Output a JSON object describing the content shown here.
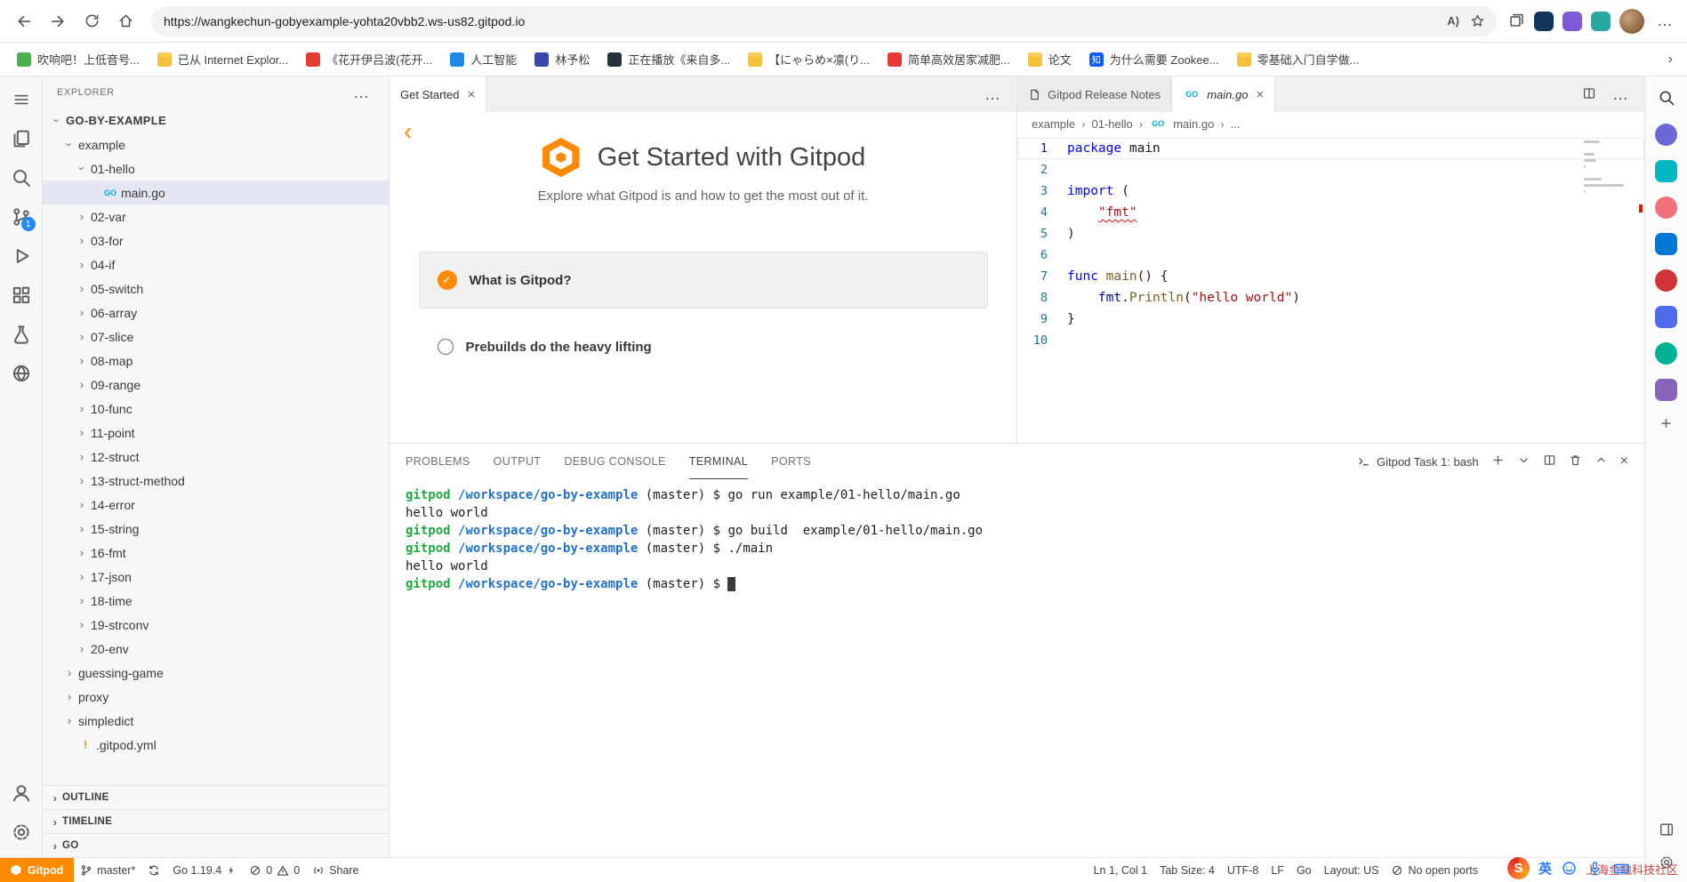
{
  "browser": {
    "toolbar": {
      "url": "https://wangkechun-gobyexample-yohta20vbb2.ws-us82.gitpod.io"
    },
    "bookmarks": [
      {
        "label": "吹响吧！上低音号...",
        "icon": "site",
        "color": "#4caf50"
      },
      {
        "label": "已从 Internet Explor...",
        "icon": "folder"
      },
      {
        "label": "《花开伊吕波(花开...",
        "icon": "site",
        "color": "#e53935"
      },
      {
        "label": "人工智能",
        "icon": "site",
        "color": "#1e88e5"
      },
      {
        "label": "林予松",
        "icon": "site",
        "color": "#3949ab"
      },
      {
        "label": "正在播放《来自多...",
        "icon": "site",
        "color": "#263238"
      },
      {
        "label": "【にゃらめ×凛(り...",
        "icon": "folder"
      },
      {
        "label": "简单高效居家减肥...",
        "icon": "site",
        "color": "#e53935"
      },
      {
        "label": "论文",
        "icon": "folder"
      },
      {
        "label": "为什么需要 Zookee...",
        "icon": "site",
        "color": "#0b5cff",
        "glyph": "知"
      },
      {
        "label": "零基础入门自学做...",
        "icon": "folder"
      }
    ]
  },
  "icons": {
    "go": "GO",
    "warn": "!",
    "read_aloud": "A)"
  },
  "activity": {
    "scm_badge": "1"
  },
  "sidebar": {
    "title": "EXPLORER",
    "tree": [
      {
        "label": "GO-BY-EXAMPLE",
        "level": 0,
        "arrow": "down",
        "root": true
      },
      {
        "label": "example",
        "level": 1,
        "arrow": "down"
      },
      {
        "label": "01-hello",
        "level": 2,
        "arrow": "down"
      },
      {
        "label": "main.go",
        "level": 3,
        "arrow": "none",
        "icon": "go",
        "selected": true
      },
      {
        "label": "02-var",
        "level": 2,
        "arrow": "right"
      },
      {
        "label": "03-for",
        "level": 2,
        "arrow": "right"
      },
      {
        "label": "04-if",
        "level": 2,
        "arrow": "right"
      },
      {
        "label": "05-switch",
        "level": 2,
        "arrow": "right"
      },
      {
        "label": "06-array",
        "level": 2,
        "arrow": "right"
      },
      {
        "label": "07-slice",
        "level": 2,
        "arrow": "right"
      },
      {
        "label": "08-map",
        "level": 2,
        "arrow": "right"
      },
      {
        "label": "09-range",
        "level": 2,
        "arrow": "right"
      },
      {
        "label": "10-func",
        "level": 2,
        "arrow": "right"
      },
      {
        "label": "11-point",
        "level": 2,
        "arrow": "right"
      },
      {
        "label": "12-struct",
        "level": 2,
        "arrow": "right"
      },
      {
        "label": "13-struct-method",
        "level": 2,
        "arrow": "right"
      },
      {
        "label": "14-error",
        "level": 2,
        "arrow": "right"
      },
      {
        "label": "15-string",
        "level": 2,
        "arrow": "right"
      },
      {
        "label": "16-fmt",
        "level": 2,
        "arrow": "right"
      },
      {
        "label": "17-json",
        "level": 2,
        "arrow": "right"
      },
      {
        "label": "18-time",
        "level": 2,
        "arrow": "right"
      },
      {
        "label": "19-strconv",
        "level": 2,
        "arrow": "right"
      },
      {
        "label": "20-env",
        "level": 2,
        "arrow": "right"
      },
      {
        "label": "guessing-game",
        "level": 1,
        "arrow": "right"
      },
      {
        "label": "proxy",
        "level": 1,
        "arrow": "right"
      },
      {
        "label": "simpledict",
        "level": 1,
        "arrow": "right"
      },
      {
        "label": ".gitpod.yml",
        "level": 1,
        "arrow": "none",
        "icon": "warn"
      }
    ],
    "sections": [
      "OUTLINE",
      "TIMELINE",
      "GO"
    ]
  },
  "get_started": {
    "tab": "Get Started",
    "title": "Get Started with Gitpod",
    "subtitle": "Explore what Gitpod is and how to get the most out of it.",
    "items": [
      {
        "label": "What is Gitpod?",
        "checked": true
      },
      {
        "label": "Prebuilds do the heavy lifting",
        "checked": false
      }
    ]
  },
  "editor": {
    "right_tabs": [
      "Gitpod Release Notes",
      "main.go"
    ],
    "breadcrumb": [
      "example",
      "01-hello",
      "main.go",
      "..."
    ],
    "lines": [
      {
        "num": "1",
        "cur": true,
        "tokens": [
          {
            "t": "package",
            "c": "kw"
          },
          {
            "t": " main",
            "c": "pl"
          }
        ]
      },
      {
        "num": "2",
        "tokens": []
      },
      {
        "num": "3",
        "tokens": [
          {
            "t": "import",
            "c": "kw"
          },
          {
            "t": " (",
            "c": "pl"
          }
        ]
      },
      {
        "num": "4",
        "tokens": [
          {
            "t": "    ",
            "c": "pl"
          },
          {
            "t": "\"fmt\"",
            "c": "str err"
          }
        ]
      },
      {
        "num": "5",
        "tokens": [
          {
            "t": ")",
            "c": "pl"
          }
        ]
      },
      {
        "num": "6",
        "tokens": []
      },
      {
        "num": "7",
        "tokens": [
          {
            "t": "func",
            "c": "kw"
          },
          {
            "t": " ",
            "c": "pl"
          },
          {
            "t": "main",
            "c": "fn"
          },
          {
            "t": "() {",
            "c": "pl"
          }
        ]
      },
      {
        "num": "8",
        "tokens": [
          {
            "t": "    ",
            "c": "pl"
          },
          {
            "t": "fmt",
            "c": "id"
          },
          {
            "t": ".",
            "c": "pl"
          },
          {
            "t": "Println",
            "c": "fn"
          },
          {
            "t": "(",
            "c": "pl"
          },
          {
            "t": "\"hello world\"",
            "c": "str"
          },
          {
            "t": ")",
            "c": "pl"
          }
        ]
      },
      {
        "num": "9",
        "tokens": [
          {
            "t": "}",
            "c": "pl"
          }
        ]
      },
      {
        "num": "10",
        "tokens": []
      }
    ]
  },
  "panel": {
    "tabs": [
      "PROBLEMS",
      "OUTPUT",
      "DEBUG CONSOLE",
      "TERMINAL",
      "PORTS"
    ],
    "task": "Gitpod Task 1: bash"
  },
  "terminal": {
    "lines": [
      {
        "tokens": [
          {
            "t": "gitpod",
            "c": "tg"
          },
          {
            "t": " ",
            "c": "tp"
          },
          {
            "t": "/workspace/go-by-example",
            "c": "tb"
          },
          {
            "t": " (master) $ go run example/01-hello/main.go",
            "c": "tp"
          }
        ]
      },
      {
        "tokens": [
          {
            "t": "hello world",
            "c": "tp"
          }
        ]
      },
      {
        "tokens": [
          {
            "t": "gitpod",
            "c": "tg"
          },
          {
            "t": " ",
            "c": "tp"
          },
          {
            "t": "/workspace/go-by-example",
            "c": "tb"
          },
          {
            "t": " (master) $ go build  example/01-hello/main.go",
            "c": "tp"
          }
        ]
      },
      {
        "tokens": [
          {
            "t": "gitpod",
            "c": "tg"
          },
          {
            "t": " ",
            "c": "tp"
          },
          {
            "t": "/workspace/go-by-example",
            "c": "tb"
          },
          {
            "t": " (master) $ ./main",
            "c": "tp"
          }
        ]
      },
      {
        "tokens": [
          {
            "t": "hello world",
            "c": "tp"
          }
        ]
      },
      {
        "tokens": [
          {
            "t": "gitpod",
            "c": "tg"
          },
          {
            "t": " ",
            "c": "tp"
          },
          {
            "t": "/workspace/go-by-example",
            "c": "tb"
          },
          {
            "t": " (master) $ ",
            "c": "tp"
          },
          {
            "t": " ",
            "c": "cursor"
          }
        ]
      }
    ]
  },
  "status_bar": {
    "gitpod": "Gitpod",
    "branch": "master*",
    "go_version": "Go 1.19.4",
    "errors": "0",
    "warnings": "0",
    "share": "Share",
    "cursor": "Ln 1, Col 1",
    "tab_size": "Tab Size: 4",
    "encoding": "UTF-8",
    "eol": "LF",
    "language": "Go",
    "layout": "Layout: US",
    "ports": "No open ports"
  },
  "edge_sidebar": {
    "apps": [
      {
        "color": "#6b69d6",
        "round": true
      },
      {
        "color": "#00b7c3",
        "round": false
      },
      {
        "color": "#f1707b",
        "round": true
      },
      {
        "color": "#0078d4",
        "round": false
      },
      {
        "color": "#d13438",
        "round": true
      },
      {
        "color": "#4f6bed",
        "round": false
      },
      {
        "color": "#00b294",
        "round": true
      },
      {
        "color": "#8764b8",
        "round": false
      }
    ]
  },
  "ime": {
    "lang": "英"
  },
  "watermark": "上海金融科技社区"
}
